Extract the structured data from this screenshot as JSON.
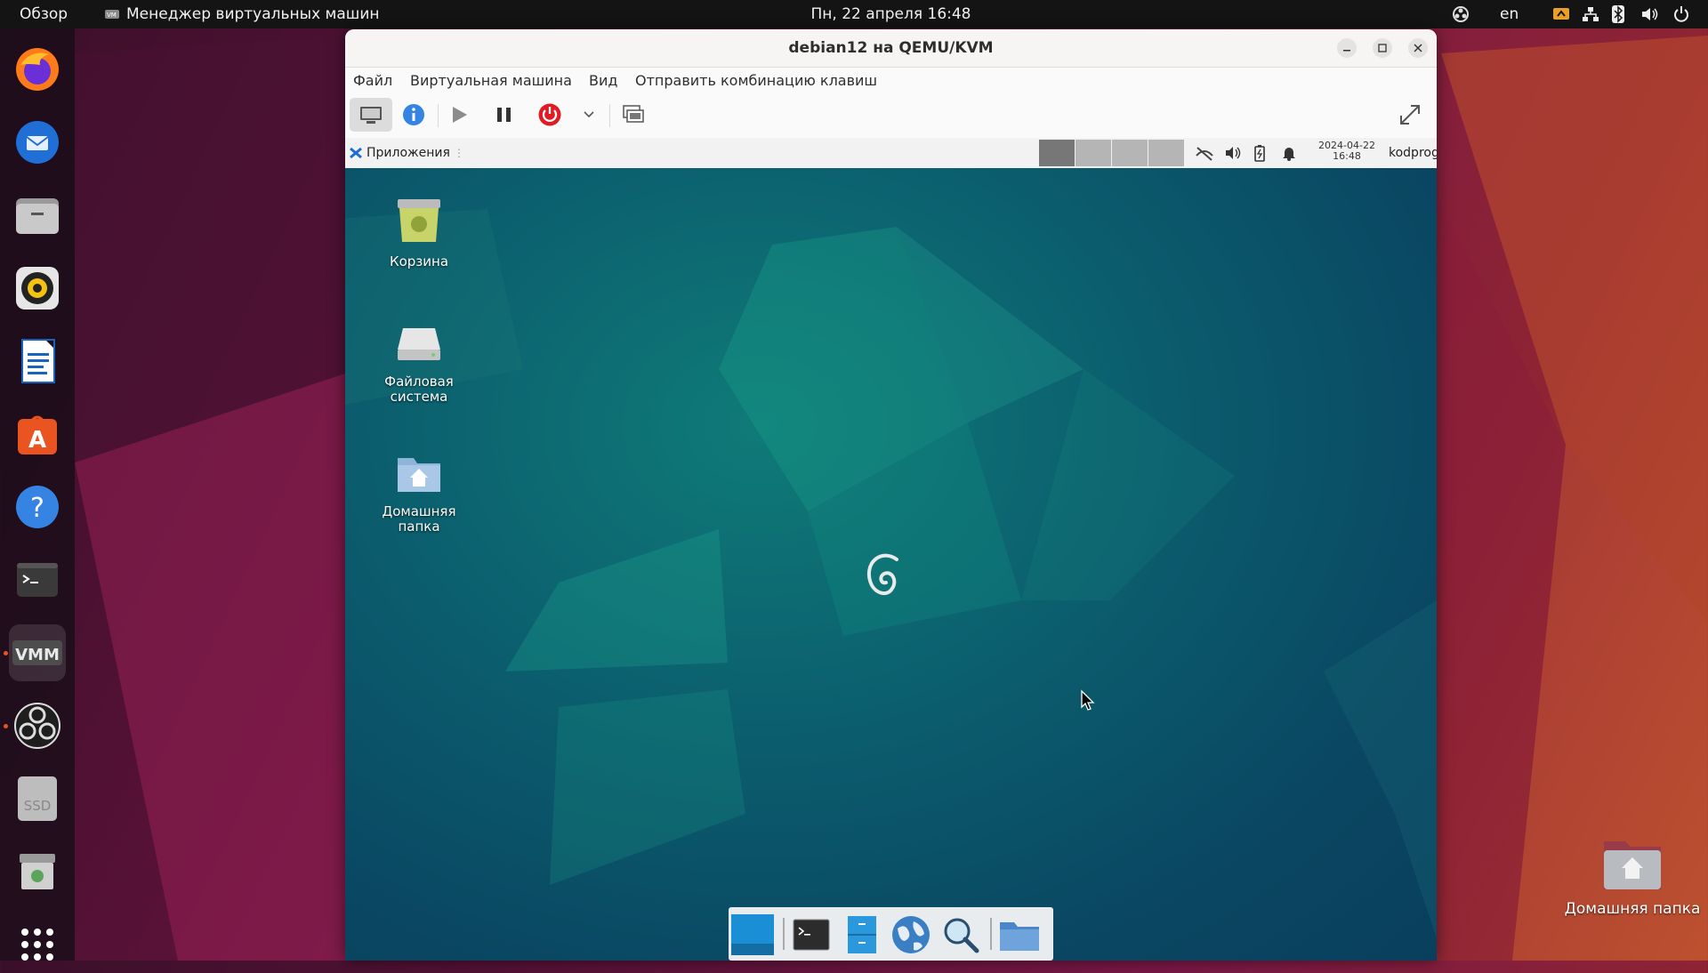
{
  "topbar": {
    "activities": "Обзор",
    "app_name": "Менеджер виртуальных машин",
    "datetime": "Пн, 22 апреля  16:48",
    "keyboard_layout": "en",
    "tray_icons": [
      "obs-tray-icon",
      "screen-share-icon",
      "network-icon",
      "bluetooth-icon",
      "volume-icon",
      "power-icon"
    ]
  },
  "dock": {
    "items": [
      "firefox",
      "thunderbird",
      "files",
      "rhythmbox",
      "libreoffice-writer",
      "app-center",
      "help",
      "terminal",
      "virt-manager",
      "obs-studio",
      "ssd-drive",
      "trash",
      "show-apps"
    ]
  },
  "window": {
    "title": "debian12 на QEMU/KVM",
    "menu": {
      "file": "Файл",
      "vm": "Виртуальная машина",
      "view": "Вид",
      "send_key": "Отправить комбинацию клавиш"
    }
  },
  "guest": {
    "panel": {
      "applications": "Приложения",
      "date": "2024-04-22",
      "time": "16:48",
      "user": "kodprog"
    },
    "desktop_icons": {
      "trash": "Корзина",
      "filesystem": "Файловая система",
      "home": "Домашняя папка"
    },
    "dock_items": [
      "show-desktop",
      "terminal",
      "file-manager",
      "web-browser",
      "app-finder",
      "folder"
    ]
  },
  "host_desktop": {
    "home_folder": "Домашняя папка"
  },
  "colors": {
    "ubuntu_orange": "#e95420",
    "power_red": "#e01b24",
    "info_blue": "#3584e4",
    "debian_teal": "#0a4762"
  }
}
